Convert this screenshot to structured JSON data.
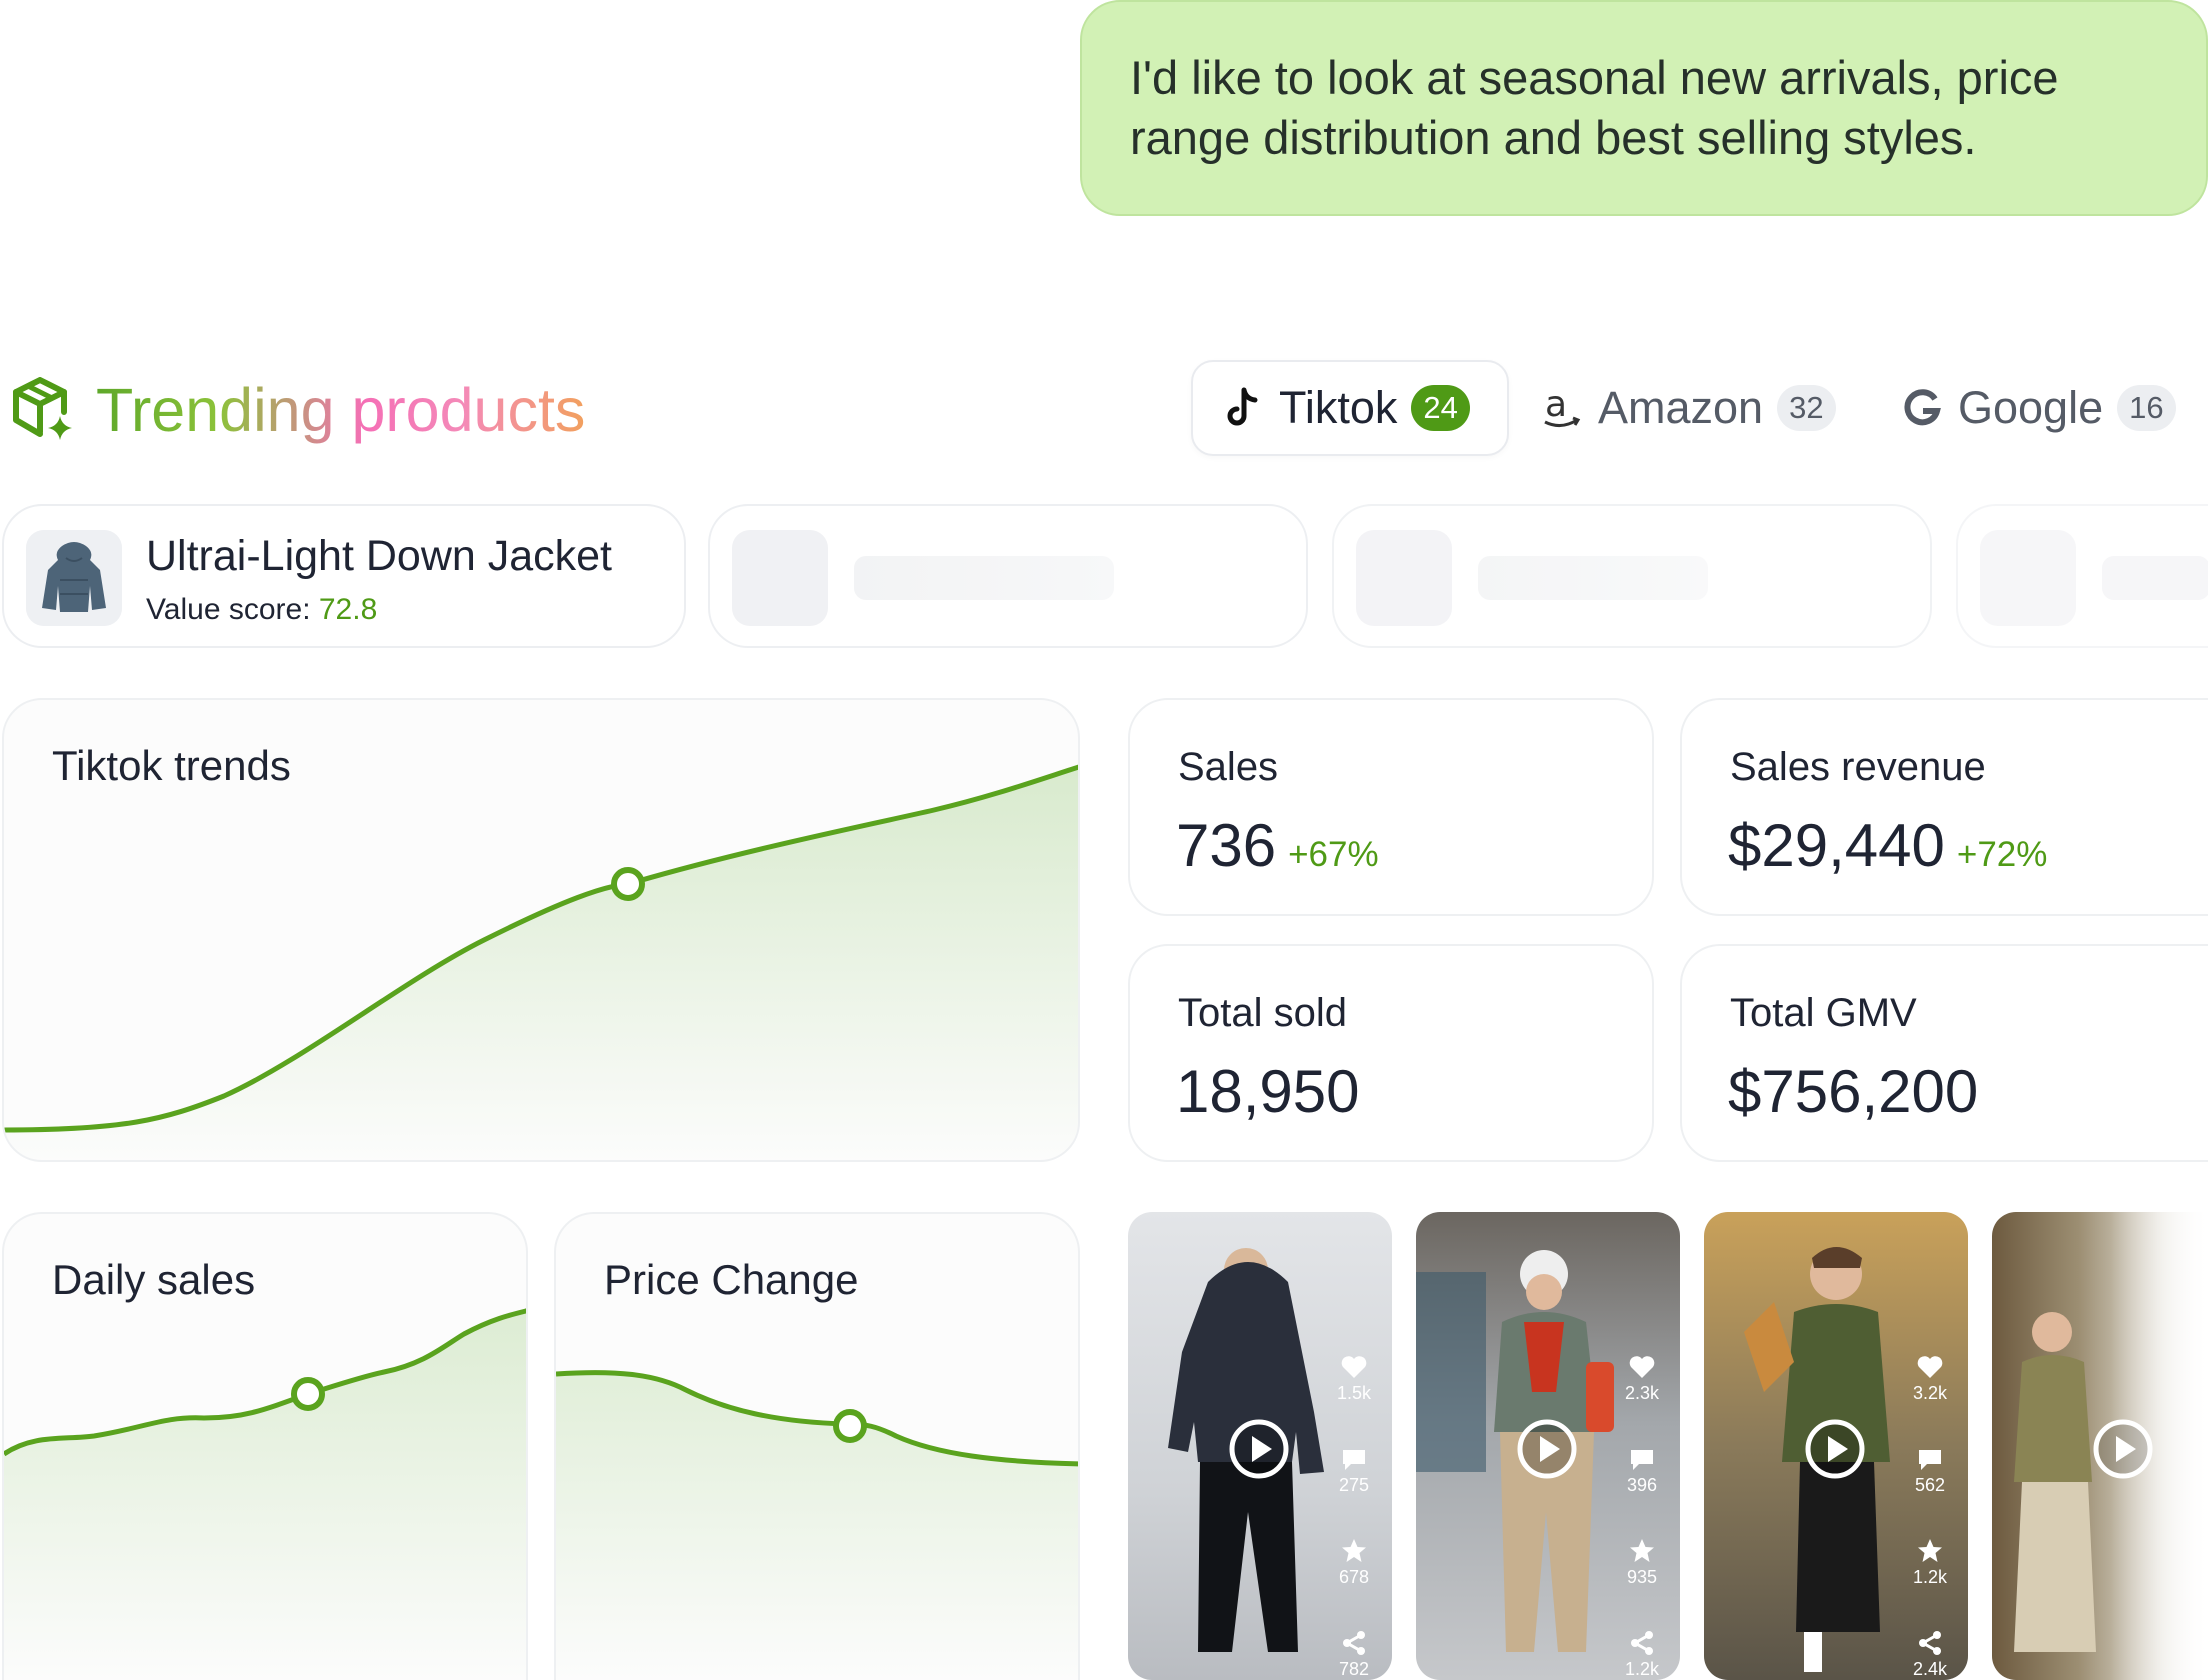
{
  "chat": {
    "message": "I'd like to look at seasonal new arrivals, price range distribution and best selling styles."
  },
  "header": {
    "title": "Trending products",
    "icon": "cube-sparkle-icon"
  },
  "tabs": [
    {
      "label": "Tiktok",
      "count": "24",
      "icon": "tiktok-icon",
      "active": true
    },
    {
      "label": "Amazon",
      "count": "32",
      "icon": "amazon-icon",
      "active": false
    },
    {
      "label": "Google",
      "count": "16",
      "icon": "google-icon",
      "active": false
    }
  ],
  "product": {
    "name": "Ultrai-Light Down Jacket",
    "score_label": "Value score:",
    "score_value": "72.8"
  },
  "trends": {
    "title": "Tiktok trends"
  },
  "daily": {
    "title": "Daily sales"
  },
  "price": {
    "title": "Price Change"
  },
  "stats": {
    "sales": {
      "label": "Sales",
      "value": "736",
      "delta": "+67%"
    },
    "revenue": {
      "label": "Sales revenue",
      "value": "$29,440",
      "delta": "+72%"
    },
    "sold": {
      "label": "Total sold",
      "value": "18,950"
    },
    "gmv": {
      "label": "Total GMV",
      "value": "$756,200"
    }
  },
  "videos": [
    {
      "likes": "1.5k",
      "comments": "275",
      "favorites": "678",
      "shares": "782"
    },
    {
      "likes": "2.3k",
      "comments": "396",
      "favorites": "935",
      "shares": "1.2k"
    },
    {
      "likes": "3.2k",
      "comments": "562",
      "favorites": "1.2k",
      "shares": "2.4k"
    }
  ],
  "colors": {
    "accent": "#4f9a16",
    "bubble": "#d2f1b5",
    "line": "#5aa31e"
  }
}
